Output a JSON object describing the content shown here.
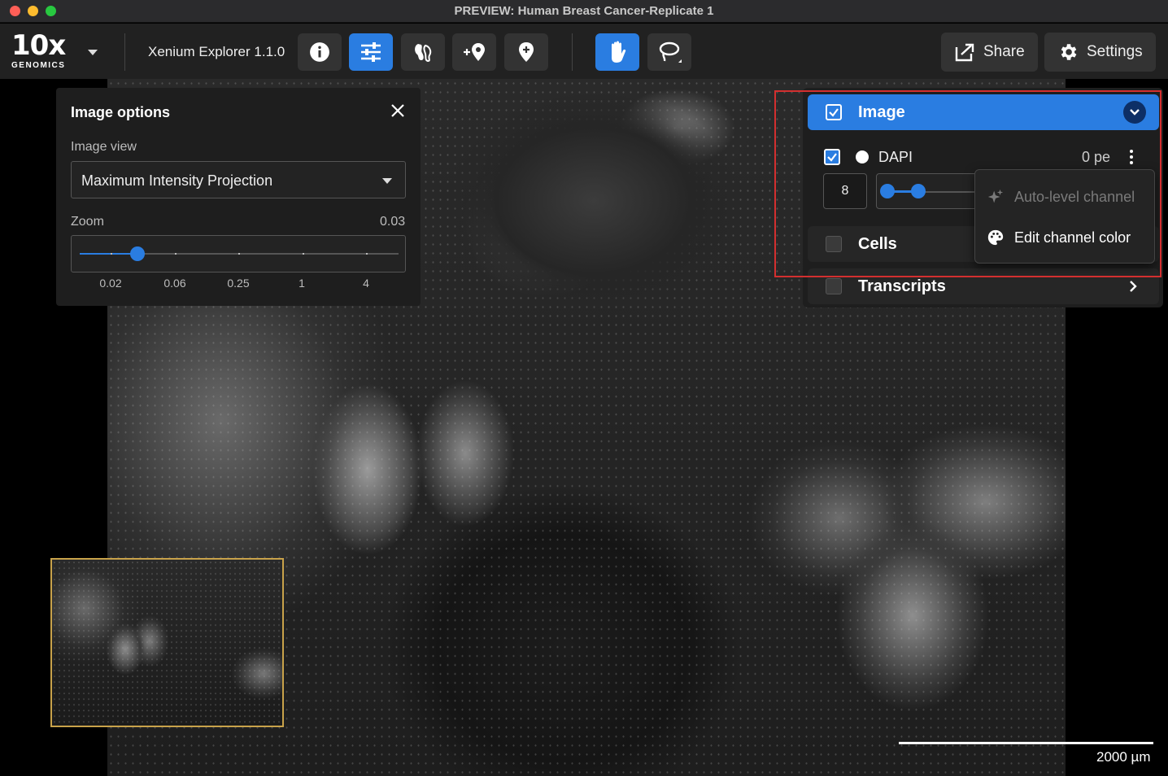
{
  "window": {
    "title": "PREVIEW: Human Breast Cancer-Replicate 1"
  },
  "toolbar": {
    "logo_text": "10x",
    "logo_subtext": "GENOMICS",
    "app_name": "Xenium Explorer 1.1.0",
    "tools": [
      {
        "icon": "info-icon",
        "active": false
      },
      {
        "icon": "sliders-icon",
        "active": true
      },
      {
        "icon": "cell-segmentation-icon",
        "active": false
      },
      {
        "icon": "add-location-icon",
        "active": false
      },
      {
        "icon": "pin-add-icon",
        "active": false
      },
      {
        "icon": "hand-pan-icon",
        "active": true
      },
      {
        "icon": "lasso-icon",
        "active": false
      }
    ],
    "share_label": "Share",
    "settings_label": "Settings"
  },
  "image_options": {
    "title": "Image options",
    "image_view_label": "Image view",
    "image_view_value": "Maximum Intensity Projection",
    "zoom_label": "Zoom",
    "zoom_value": "0.03",
    "zoom_ticks": [
      "0.02",
      "0.06",
      "0.25",
      "1",
      "4"
    ]
  },
  "layers": {
    "image": {
      "label": "Image",
      "checked": true
    },
    "channel": {
      "name": "DAPI",
      "value": "0 pe",
      "min_input": "8",
      "checked": true
    },
    "cells": {
      "label": "Cells",
      "checked": false
    },
    "transcripts": {
      "label": "Transcripts",
      "checked": false
    }
  },
  "context_menu": {
    "items": [
      {
        "label": "Auto-level channel",
        "icon": "sparkle-icon",
        "enabled": false
      },
      {
        "label": "Edit channel color",
        "icon": "palette-icon",
        "enabled": true
      }
    ]
  },
  "scale_bar": {
    "label": "2000 µm"
  },
  "colors": {
    "accent": "#2a7de1",
    "highlight_border": "#d32f2f",
    "minimap_border": "#c8a24a",
    "panel_bg": "#1e1e1e"
  }
}
